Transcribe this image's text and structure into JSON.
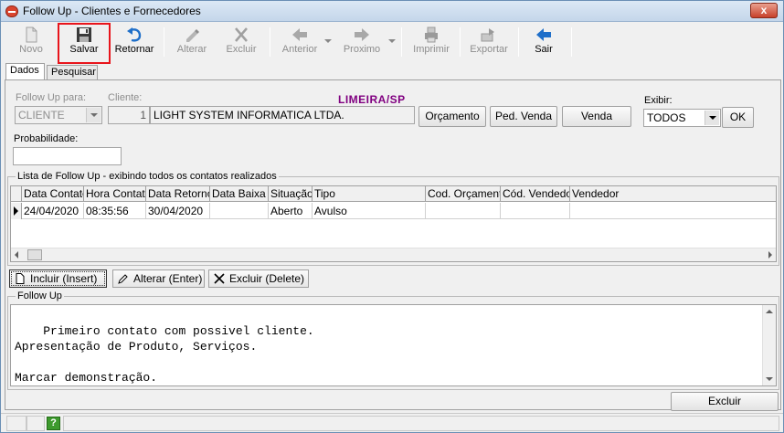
{
  "window": {
    "title": "Follow Up - Clientes e Fornecedores",
    "close_label": "x"
  },
  "toolbar": {
    "novo": "Novo",
    "salvar": "Salvar",
    "retornar": "Retornar",
    "alterar": "Alterar",
    "excluir": "Excluir",
    "anterior": "Anterior",
    "proximo": "Proximo",
    "imprimir": "Imprimir",
    "exportar": "Exportar",
    "sair": "Sair"
  },
  "tabs": [
    {
      "label": "Dados"
    },
    {
      "label": "Pesquisar"
    }
  ],
  "form": {
    "followup_para_label": "Follow Up para:",
    "followup_para_value": "CLIENTE",
    "cliente_label": "Cliente:",
    "cliente_code": "1",
    "cliente_name": "LIGHT SYSTEM INFORMATICA LTDA.",
    "city": "LIMEIRA/SP",
    "orcamento_btn": "Orçamento",
    "ped_venda_btn": "Ped. Venda",
    "venda_btn": "Venda",
    "exibir_label": "Exibir:",
    "exibir_value": "TODOS",
    "ok_btn": "OK",
    "probabilidade_label": "Probabilidade:",
    "probabilidade_value": ""
  },
  "list": {
    "title": "Lista de Follow Up - exibindo todos os contatos realizados",
    "columns": [
      "Data Contato",
      "Hora Contato",
      "Data Retorno",
      "Data Baixa",
      "Situação",
      "Tipo",
      "Cod. Orçamento",
      "Cód. Vendedor",
      "Vendedor"
    ],
    "rows": [
      {
        "data_contato": "24/04/2020",
        "hora_contato": "08:35:56",
        "data_retorno": "30/04/2020",
        "data_baixa": "",
        "situacao": "Aberto",
        "tipo": "Avulso",
        "cod_orcamento": "",
        "cod_vendedor": "",
        "vendedor": ""
      }
    ]
  },
  "actions": {
    "incluir": "Incluir (Insert)",
    "alterar": "Alterar (Enter)",
    "excluir": "Excluir (Delete)"
  },
  "followup": {
    "title": "Follow Up",
    "text": "Primeiro contato com possivel cliente.\nApresentação de Produto, Serviços.\n\nMarcar demonstração."
  },
  "bottom": {
    "excluir_btn": "Excluir"
  },
  "statusbar": {
    "help_label": "?"
  },
  "colors": {
    "highlight": "#e8141b",
    "city": "#800080",
    "help": "#3d9a2e"
  }
}
